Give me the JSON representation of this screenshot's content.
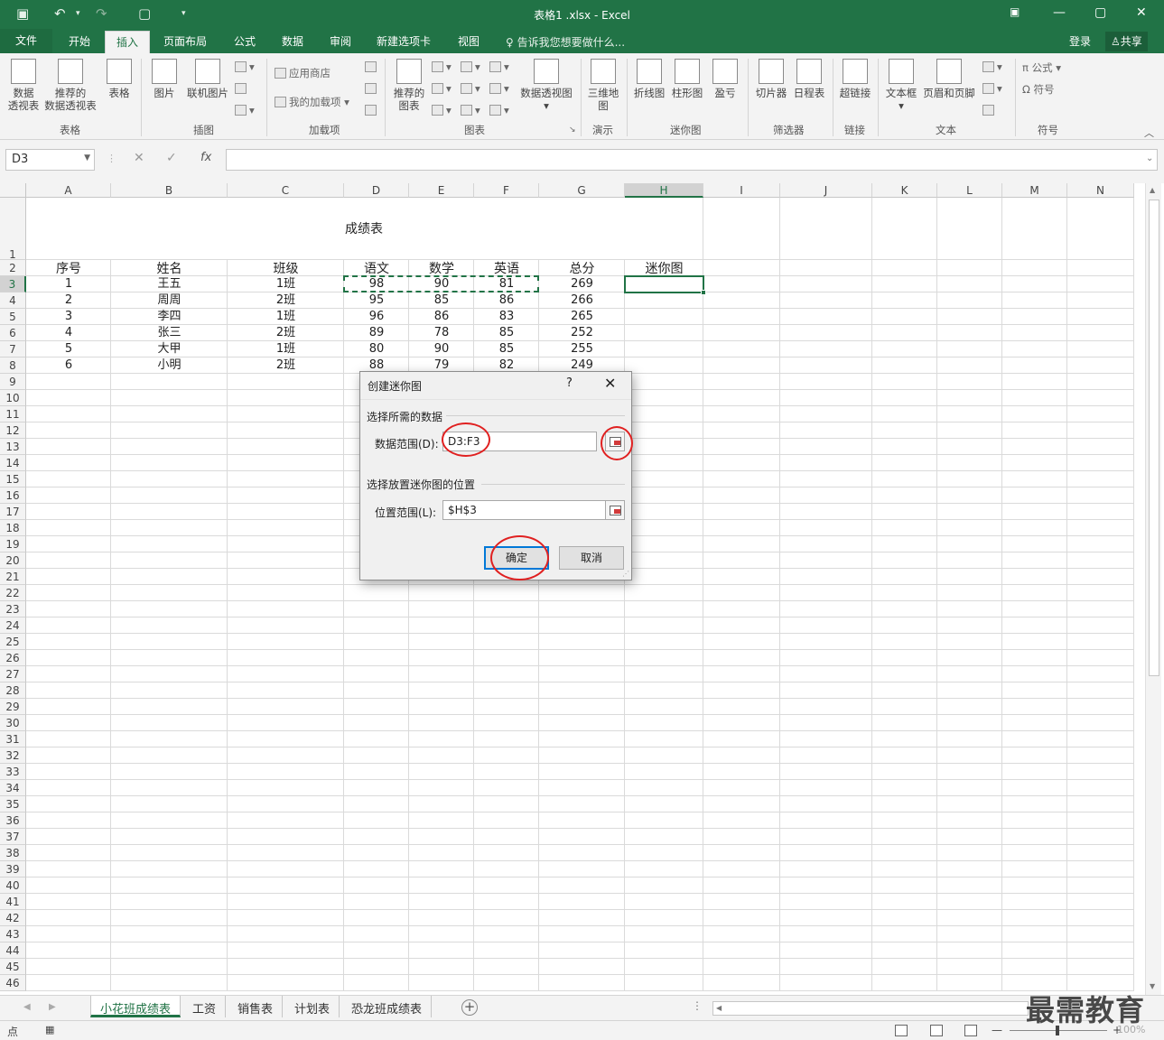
{
  "app": {
    "window_title": "表格1 .xlsx  -  Excel",
    "sign_in": "登录",
    "share": "共享"
  },
  "ribbon_tabs": [
    {
      "label": "文件"
    },
    {
      "label": "开始"
    },
    {
      "label": "插入"
    },
    {
      "label": "页面布局"
    },
    {
      "label": "公式"
    },
    {
      "label": "数据"
    },
    {
      "label": "审阅"
    },
    {
      "label": "新建选项卡"
    },
    {
      "label": "视图"
    }
  ],
  "tell_me": "告诉我您想要做什么...",
  "ribbon": {
    "tables": {
      "group": "表格",
      "pivot": "数据\n透视表",
      "recommended_pivot": "推荐的\n数据透视表",
      "table": "表格"
    },
    "illustrations": {
      "group": "插图",
      "picture": "图片",
      "online_picture": "联机图片"
    },
    "addins": {
      "group": "加载项",
      "store": "应用商店",
      "my_addins": "我的加载项"
    },
    "charts": {
      "group": "图表",
      "recommended": "推荐的\n图表",
      "pivot_chart": "数据透视图"
    },
    "tours": {
      "group": "演示",
      "map3d": "三维地\n图"
    },
    "sparklines": {
      "group": "迷你图",
      "line": "折线图",
      "column": "柱形图",
      "winloss": "盈亏"
    },
    "filters": {
      "group": "筛选器",
      "slicer": "切片器",
      "timeline": "日程表"
    },
    "links": {
      "group": "链接",
      "hyperlink": "超链接"
    },
    "text": {
      "group": "文本",
      "textbox": "文本框",
      "header_footer": "页眉和页脚"
    },
    "symbols": {
      "group": "符号",
      "equation": "公式",
      "symbol": "符号"
    }
  },
  "formula_bar": {
    "name_box": "D3",
    "fx": "fx",
    "formula": ""
  },
  "columns": [
    "A",
    "B",
    "C",
    "D",
    "E",
    "F",
    "G",
    "H",
    "I",
    "J",
    "K",
    "L",
    "M",
    "N"
  ],
  "rows": [
    "1",
    "2",
    "3",
    "4",
    "5",
    "6",
    "7",
    "8",
    "9",
    "10",
    "11",
    "12",
    "13",
    "14",
    "15",
    "16",
    "17",
    "18",
    "19",
    "20",
    "21",
    "22",
    "23",
    "24",
    "25",
    "26",
    "27",
    "28",
    "29",
    "30",
    "31",
    "32",
    "33",
    "34",
    "35",
    "36",
    "37",
    "38",
    "39",
    "40",
    "41",
    "42",
    "43",
    "44",
    "45",
    "46"
  ],
  "sheet": {
    "title": "成绩表",
    "headers": [
      "序号",
      "姓名",
      "班级",
      "语文",
      "数学",
      "英语",
      "总分",
      "迷你图"
    ],
    "data": [
      [
        "1",
        "王五",
        "1班",
        "98",
        "90",
        "81",
        "269"
      ],
      [
        "2",
        "周周",
        "2班",
        "95",
        "85",
        "86",
        "266"
      ],
      [
        "3",
        "李四",
        "1班",
        "96",
        "86",
        "83",
        "265"
      ],
      [
        "4",
        "张三",
        "2班",
        "89",
        "78",
        "85",
        "252"
      ],
      [
        "5",
        "大甲",
        "1班",
        "80",
        "90",
        "85",
        "255"
      ],
      [
        "6",
        "小明",
        "2班",
        "88",
        "79",
        "82",
        "249"
      ]
    ]
  },
  "sheet_tabs": [
    "小花班成绩表",
    "工资",
    "销售表",
    "计划表",
    "恐龙班成绩表"
  ],
  "status": {
    "mode": "点",
    "zoom": "100%"
  },
  "dialog": {
    "title": "创建迷你图",
    "help": "?",
    "close": "✕",
    "section_data": "选择所需的数据",
    "data_range_label": "数据范围(D):",
    "data_range_value": "D3:F3",
    "section_location": "选择放置迷你图的位置",
    "location_label": "位置范围(L):",
    "location_value": "$H$3",
    "ok": "确定",
    "cancel": "取消"
  },
  "watermark": "最需教育",
  "colors": {
    "accent": "#217346",
    "highlight_ring": "#e02020",
    "default_button": "#0078d7"
  }
}
